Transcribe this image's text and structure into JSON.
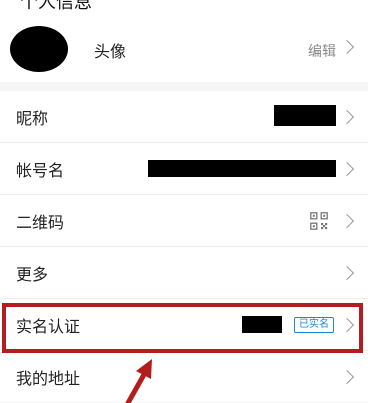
{
  "header": {
    "title": "个人信息"
  },
  "avatar_row": {
    "label": "头像",
    "action": "编辑"
  },
  "rows": [
    {
      "label": "昵称"
    },
    {
      "label": "帐号名"
    },
    {
      "label": "二维码"
    },
    {
      "label": "更多"
    },
    {
      "label": "实名认证",
      "badge": "已实名"
    },
    {
      "label": "我的地址"
    }
  ],
  "colors": {
    "highlight": "#b31d1d",
    "badge": "#1c88d4"
  },
  "icons": [
    "chevron-right-icon",
    "qr-code-icon",
    "annotation-arrow-icon"
  ]
}
